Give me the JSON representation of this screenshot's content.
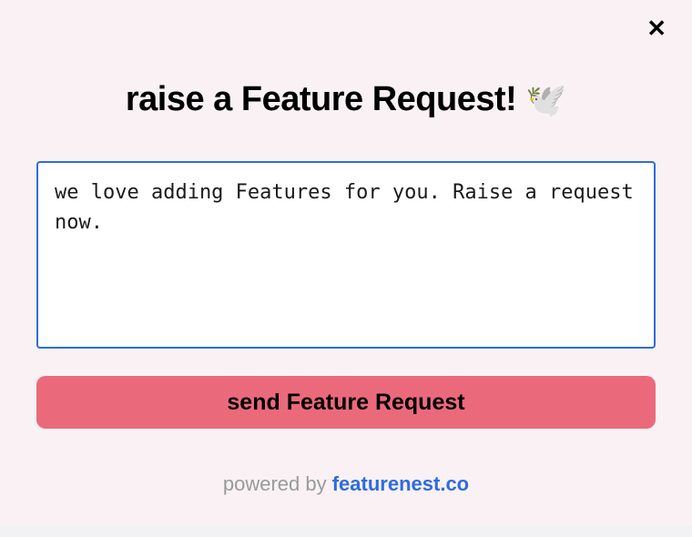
{
  "close": {
    "glyph": "✕"
  },
  "header": {
    "title": "raise a Feature Request!",
    "icon_glyph": "🕊️"
  },
  "form": {
    "textarea_value": "we love adding Features for you. Raise a request now.",
    "submit_label": "send Feature Request"
  },
  "footer": {
    "prefix": "powered by ",
    "link_text": "featurenest.co"
  },
  "colors": {
    "background": "#faf1f5",
    "accent_blue": "#2d6cdf",
    "button_pink": "#ea6a7c"
  }
}
